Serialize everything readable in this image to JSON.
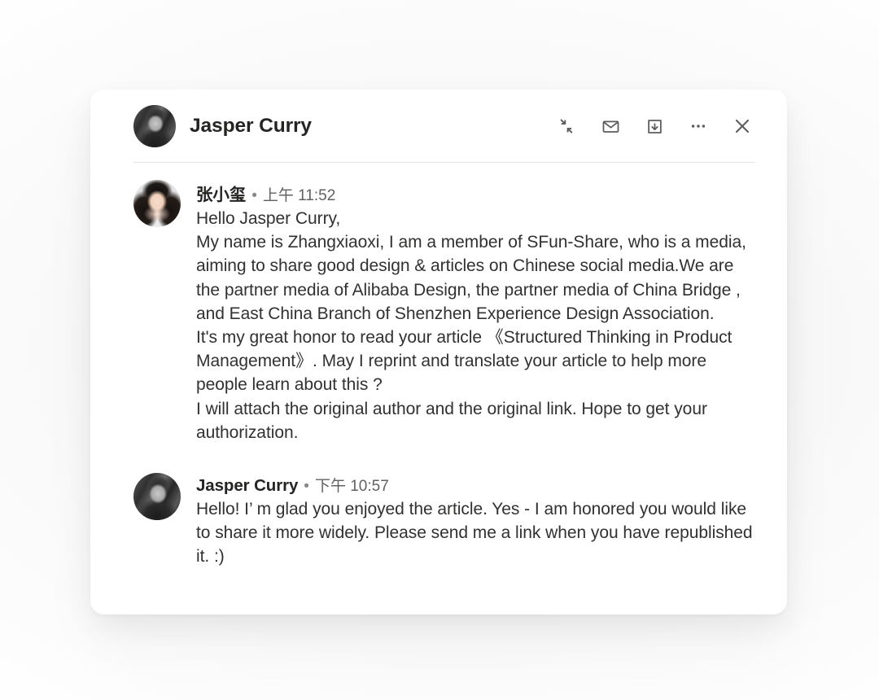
{
  "window": {
    "background_color": "#ffffff",
    "card_background": "#ffffff"
  },
  "header": {
    "title": "Jasper Curry",
    "avatar_name": "jasper-curry-avatar",
    "actions": [
      {
        "id": "collapse",
        "label": "Collapse",
        "icon": "collapse-icon"
      },
      {
        "id": "mail",
        "label": "Mail",
        "icon": "envelope-icon"
      },
      {
        "id": "archive",
        "label": "Archive",
        "icon": "archive-download-icon"
      },
      {
        "id": "more",
        "label": "More options",
        "icon": "more-horizontal-icon"
      },
      {
        "id": "close",
        "label": "Close",
        "icon": "close-icon"
      }
    ]
  },
  "messages": [
    {
      "author": "张小玺",
      "separator": "•",
      "time": "上午 11:52",
      "avatar_name": "zhangxiaoxi-avatar",
      "text": "Hello Jasper Curry,\nMy name is Zhangxiaoxi, I am a member of SFun-Share, who is a media, aiming to share good design & articles on Chinese social media.We are the partner media of Alibaba Design, the partner media of China Bridge , and East China Branch of Shenzhen Experience Design Association.\nIt's my great honor to read your article 《Structured Thinking in Product Management》. May I reprint and translate your article to help more people learn about this ?\nI will attach the original author and the original link. Hope to get your authorization."
    },
    {
      "author": "Jasper Curry",
      "separator": "•",
      "time": "下午 10:57",
      "avatar_name": "jasper-curry-avatar",
      "text": "Hello! I’ m glad you enjoyed the article. Yes - I am honored you would like to share it more widely. Please send me a link when you have republished it. :)"
    }
  ],
  "colors": {
    "text_primary": "#252423",
    "text_body": "#323130",
    "text_secondary": "#616161",
    "icon": "#5c5c5c",
    "divider": "#e4e4e6"
  }
}
